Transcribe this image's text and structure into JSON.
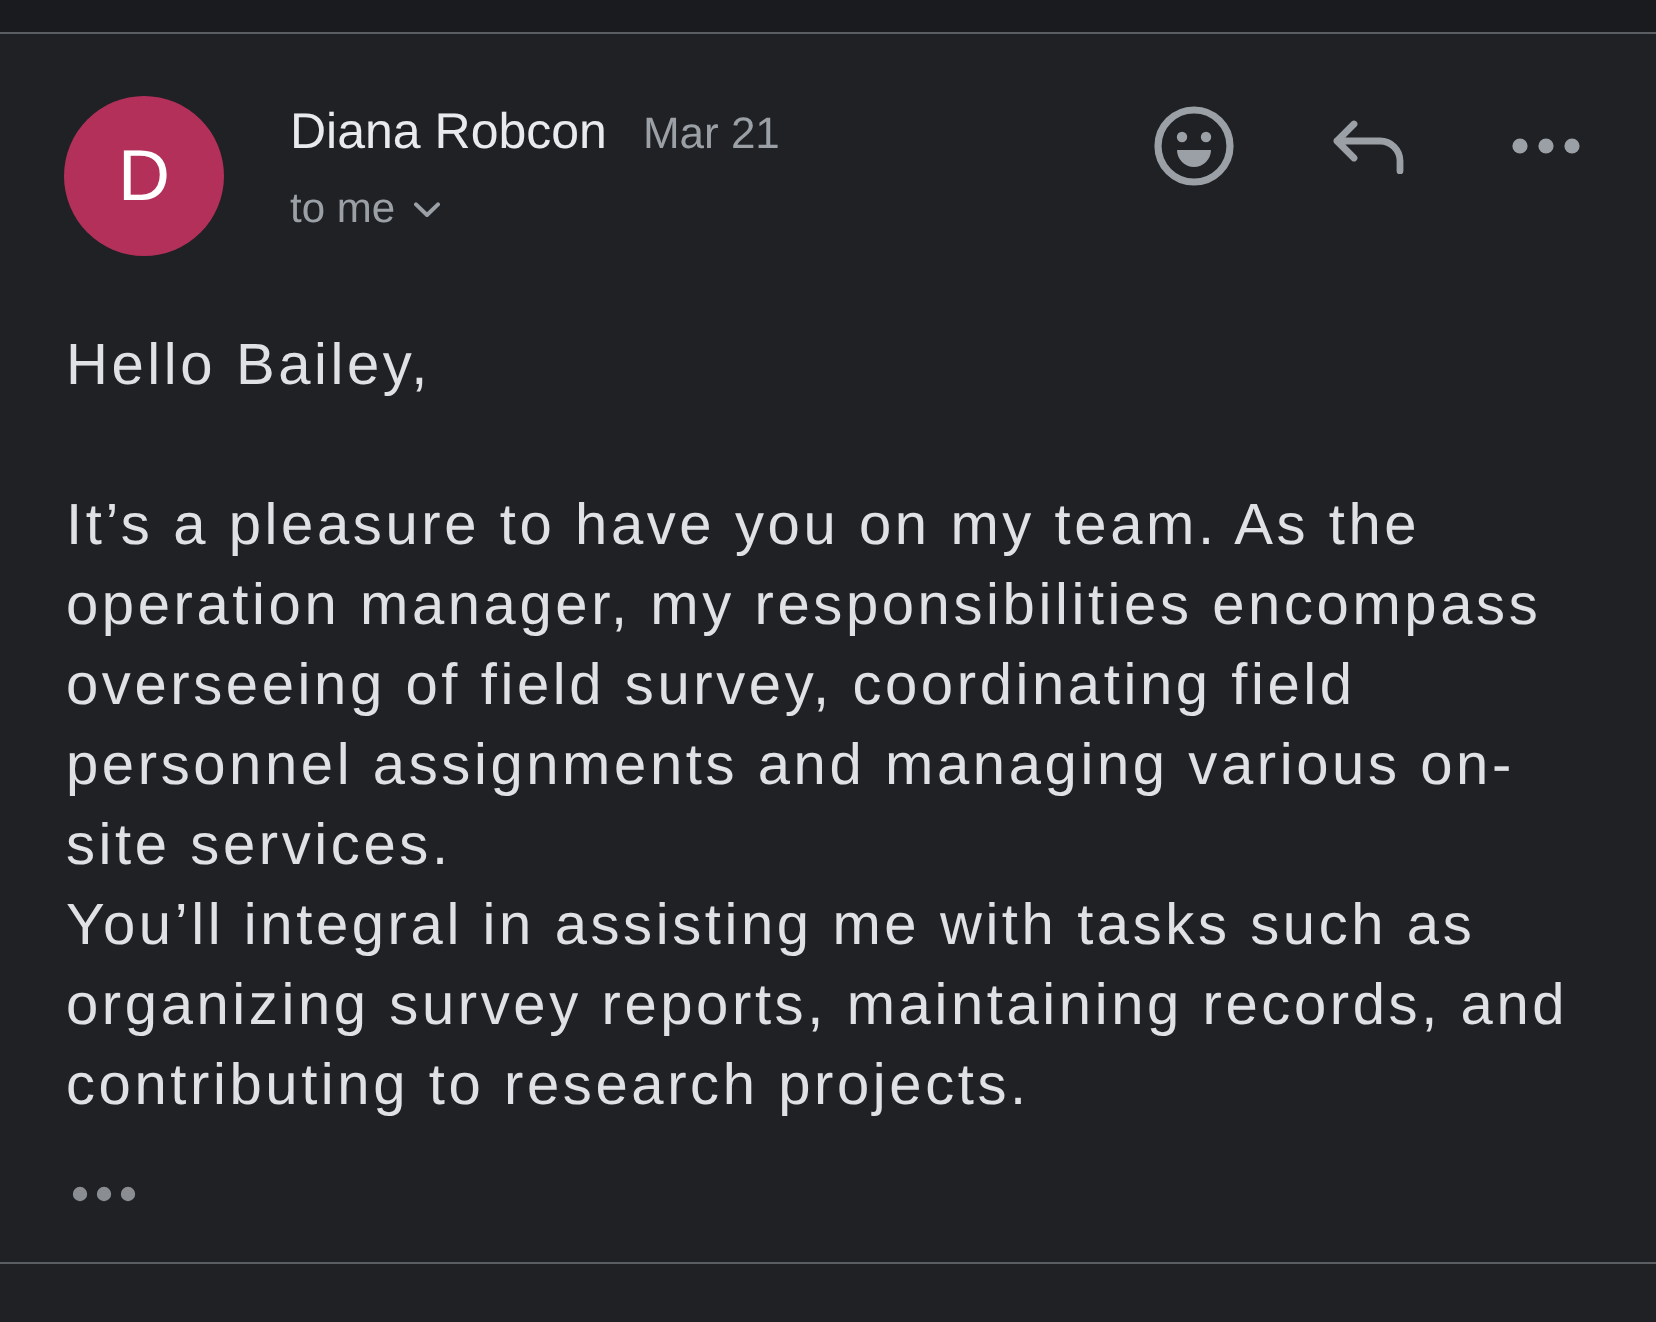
{
  "message": {
    "sender": {
      "initial": "D",
      "name": "Diana Robcon"
    },
    "date": "Mar 21",
    "recipient": "to me"
  },
  "body": {
    "greeting": "Hello Bailey,",
    "paragraphs": [
      "It’s a pleasure to have you on my team. As the operation manager, my responsibilities encompass overseeing of field survey, coordinating field personnel assignments and managing various on-site services.",
      "You’ll integral in assisting me with tasks such as organizing survey reports, maintaining records, and contributing to research projects."
    ]
  }
}
